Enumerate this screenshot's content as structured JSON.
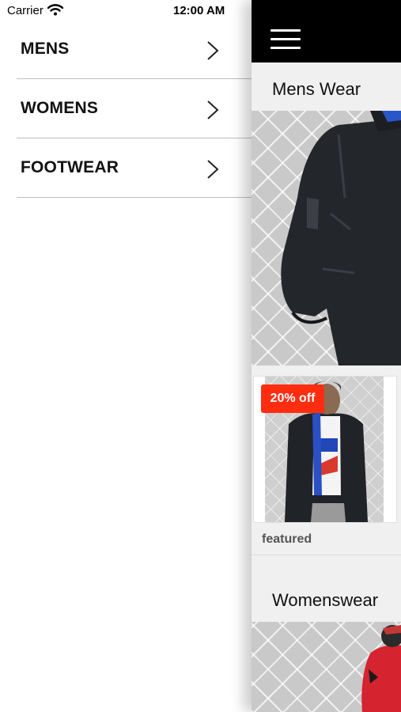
{
  "status_bar": {
    "carrier": "Carrier",
    "time": "12:00 AM"
  },
  "menu": {
    "items": [
      {
        "label": "MENS"
      },
      {
        "label": "WOMENS"
      },
      {
        "label": "FOOTWEAR"
      }
    ]
  },
  "panel": {
    "sections": [
      {
        "title": "Mens Wear"
      },
      {
        "title": "Womenswear"
      }
    ],
    "product": {
      "badge": "20% off",
      "tag": "featured"
    }
  },
  "colors": {
    "badge": "#ff2d10",
    "topbar": "#000000",
    "panel_bg": "#f0f0f0"
  },
  "icons": [
    "wifi-icon",
    "chevron-right-icon",
    "hamburger-menu-icon"
  ]
}
